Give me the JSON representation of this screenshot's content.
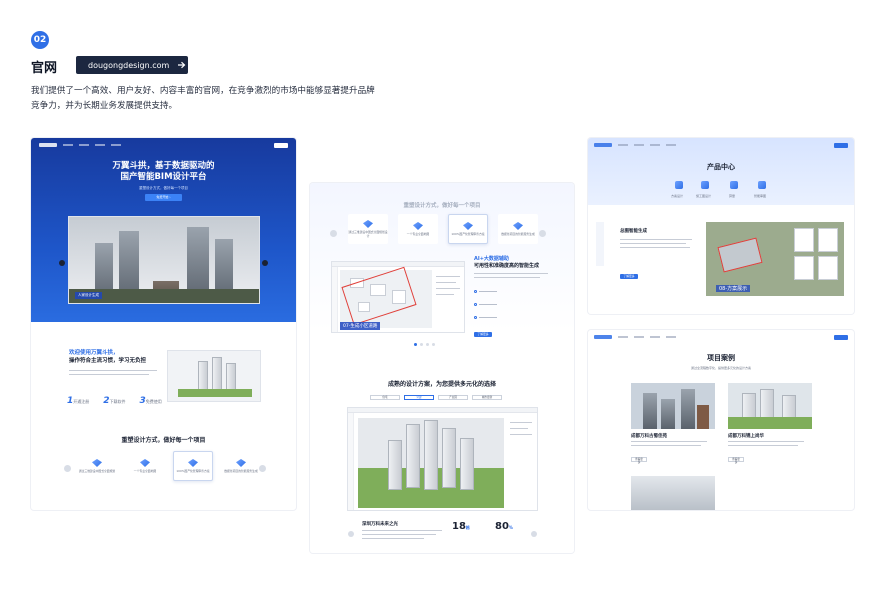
{
  "header": {
    "number": "02",
    "title": "官网",
    "domain": "dougongdesign.com",
    "arrow_icon": "arrow-right-icon",
    "description": "我们提供了一个高效、用户友好、内容丰富的官网，在竞争激烈的市场中能够显著提升品牌竞争力，并为长期业务发展提供支持。"
  },
  "left": {
    "brand": "万翼斗拱",
    "hero_title_1": "万翼斗拱，基于数据驱动的",
    "hero_title_2": "国产智能BIM设计平台",
    "hero_sub": "重塑设计方式，做好每一个项目",
    "hero_cta": "免费开始 ›",
    "caption": "人家设计生成",
    "welcome_1": "欢迎使用万翼斗拱，",
    "welcome_2": "操作符合主流习惯，学习无负担",
    "steps": [
      "1",
      "2",
      "3"
    ],
    "steps_labels": [
      "开通注册",
      "下载软件",
      "免费使用"
    ],
    "section_title": "重塑设计方式，做好每一个项目",
    "cards": [
      "通过三维建设中国式全面规划",
      "一个专业全面地图",
      "100%国产化管理审查方案",
      "数据化项目的智能服务生成"
    ]
  },
  "middle": {
    "section_title": "重塑设计方式，做好每一个项目",
    "cards": [
      "通过三维建设中国式全面规划设计",
      "一个专业全面地图",
      "100%国产化管理审查方案",
      "数据化项目的智能服务生成"
    ],
    "caption": "07-生成小区道路",
    "ai_1": "AI+大数据辅助",
    "ai_2": "可用性和准确度高的智能生成",
    "cta": "了解更多",
    "section2_title": "成熟的设计方案，为您提供多元化的选择",
    "tabs": [
      "住宅",
      "公建",
      "产业园",
      "城市更新"
    ],
    "project_title": "深圳万科未来之光",
    "stat1_num": "18",
    "stat1_unit": "栋",
    "stat2_num": "80",
    "stat2_unit": "%"
  },
  "right_top": {
    "brand": "万翼斗拱",
    "title": "产品中心",
    "tabs": [
      "方案设计",
      "施工图设计",
      "算量",
      "智能审图"
    ],
    "feature_title": "总图智能生成",
    "feature_cta": "了解更多",
    "caption": "08-方案展示"
  },
  "right_bottom": {
    "title": "项目案例",
    "subtitle": "通过全流程数字化，提供更多元化的设计方案",
    "case1": "成都万科古蜀佳苑",
    "case2": "成都万科锦上尚华",
    "more": "查看更多"
  }
}
